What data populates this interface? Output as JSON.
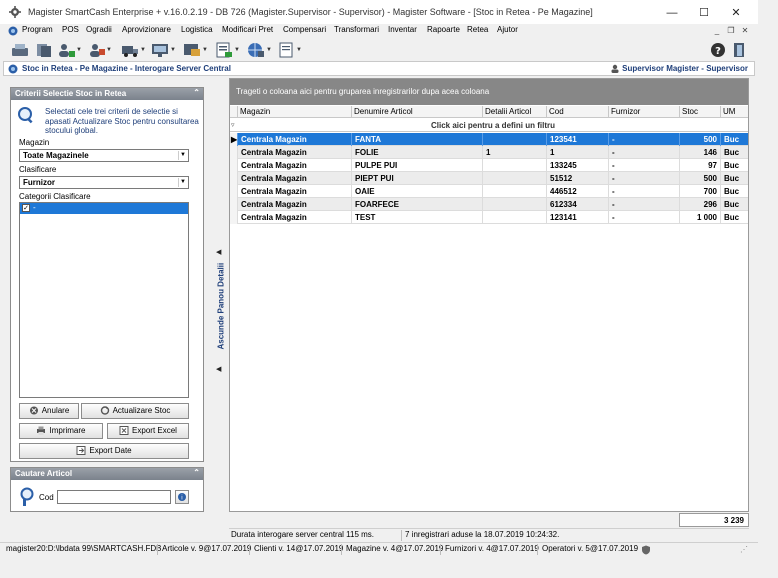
{
  "window": {
    "title": "Magister SmartCash Enterprise + v.16.0.2.19 - DB 726 (Magister.Supervisor - Supervisor) - Magister Software - [Stoc in Retea - Pe Magazine]",
    "minimize": "—",
    "maximize": "☐",
    "close": "✕"
  },
  "menu": [
    {
      "label": "Program",
      "ul": "P"
    },
    {
      "label": "POS",
      "ul": "O"
    },
    {
      "label": "Ogradii",
      "ul": "O"
    },
    {
      "label": "Aprovizionare",
      "ul": "A"
    },
    {
      "label": "Logistica",
      "ul": "L"
    },
    {
      "label": "Modificari Pret",
      "ul": "M"
    },
    {
      "label": "Compensari",
      "ul": "p"
    },
    {
      "label": "Transformari",
      "ul": "T"
    },
    {
      "label": "Inventar",
      "ul": "I"
    },
    {
      "label": "Rapoarte",
      "ul": "R"
    },
    {
      "label": "Retea",
      "ul": "R"
    },
    {
      "label": "Ajutor",
      "ul": "A"
    }
  ],
  "breadcrumb": "Stoc in Retea - Pe Magazine - Interogare Server Central",
  "user": "Supervisor Magister - Supervisor",
  "criteria_panel": {
    "title": "Criterii Selectie Stoc in Retea",
    "hint": "Selectati cele trei criterii de selectie si apasati Actualizare Stoc pentru consultarea stocului global.",
    "magazin_label": "Magazin",
    "magazin_value": "Toate Magazinele",
    "clasificare_label": "Clasificare",
    "clasificare_value": "Furnizor",
    "categorii_label": "Categorii Clasificare",
    "categorie_item": "-",
    "btn_anulare": "Anulare",
    "btn_actualizare": "Actualizare Stoc",
    "btn_imprimare": "Imprimare",
    "btn_export_excel": "Export Excel",
    "btn_export_date": "Export Date"
  },
  "search_panel": {
    "title": "Cautare Articol",
    "cod_label": "Cod",
    "cod_value": ""
  },
  "splitter_label": "Ascunde Panou Detalii",
  "grid": {
    "group_hint": "Trageti o coloana aici pentru gruparea inregistrarilor dupa acea coloana",
    "filter_hint": "Click aici pentru a defini un filtru",
    "columns": [
      "Magazin",
      "Denumire Articol",
      "Detalii Articol",
      "Cod",
      "Furnizor",
      "Stoc",
      "UM"
    ],
    "rows": [
      {
        "magazin": "Centrala Magazin",
        "denumire": "FANTA",
        "detalii": "",
        "cod": "123541",
        "furnizor": "-",
        "stoc": "500",
        "um": "Buc"
      },
      {
        "magazin": "Centrala Magazin",
        "denumire": "FOLIE",
        "detalii": "1",
        "cod": "1",
        "furnizor": "-",
        "stoc": "146",
        "um": "Buc"
      },
      {
        "magazin": "Centrala Magazin",
        "denumire": "PULPE PUI",
        "detalii": "",
        "cod": "133245",
        "furnizor": "-",
        "stoc": "97",
        "um": "Buc"
      },
      {
        "magazin": "Centrala Magazin",
        "denumire": "PIEPT PUI",
        "detalii": "",
        "cod": "51512",
        "furnizor": "-",
        "stoc": "500",
        "um": "Buc"
      },
      {
        "magazin": "Centrala Magazin",
        "denumire": "OAIE",
        "detalii": "",
        "cod": "446512",
        "furnizor": "-",
        "stoc": "700",
        "um": "Buc"
      },
      {
        "magazin": "Centrala Magazin",
        "denumire": "FOARFECE",
        "detalii": "",
        "cod": "612334",
        "furnizor": "-",
        "stoc": "296",
        "um": "Buc"
      },
      {
        "magazin": "Centrala Magazin",
        "denumire": "TEST",
        "detalii": "",
        "cod": "123141",
        "furnizor": "-",
        "stoc": "1 000",
        "um": "Buc"
      }
    ],
    "total_stoc": "3 239"
  },
  "grid_status": {
    "duration": "Durata interogare server central 115 ms.",
    "records": "7 inregistrari aduse la 18.07.2019 10:24:32."
  },
  "statusbar": {
    "db": "magister20:D:\\lbdata 99\\SMARTCASH.FDB",
    "articole": "Articole v. 9@17.07.2019",
    "clienti": "Clienti v. 14@17.07.2019",
    "magazine": "Magazine v. 4@17.07.2019",
    "furnizori": "Furnizori v. 4@17.07.2019",
    "operatori": "Operatori v. 5@17.07.2019"
  },
  "colors": {
    "selection": "#1e78d7",
    "header_band": "#878787",
    "panel_header": "#7b828c",
    "crumb_text": "#1f3f7a"
  }
}
